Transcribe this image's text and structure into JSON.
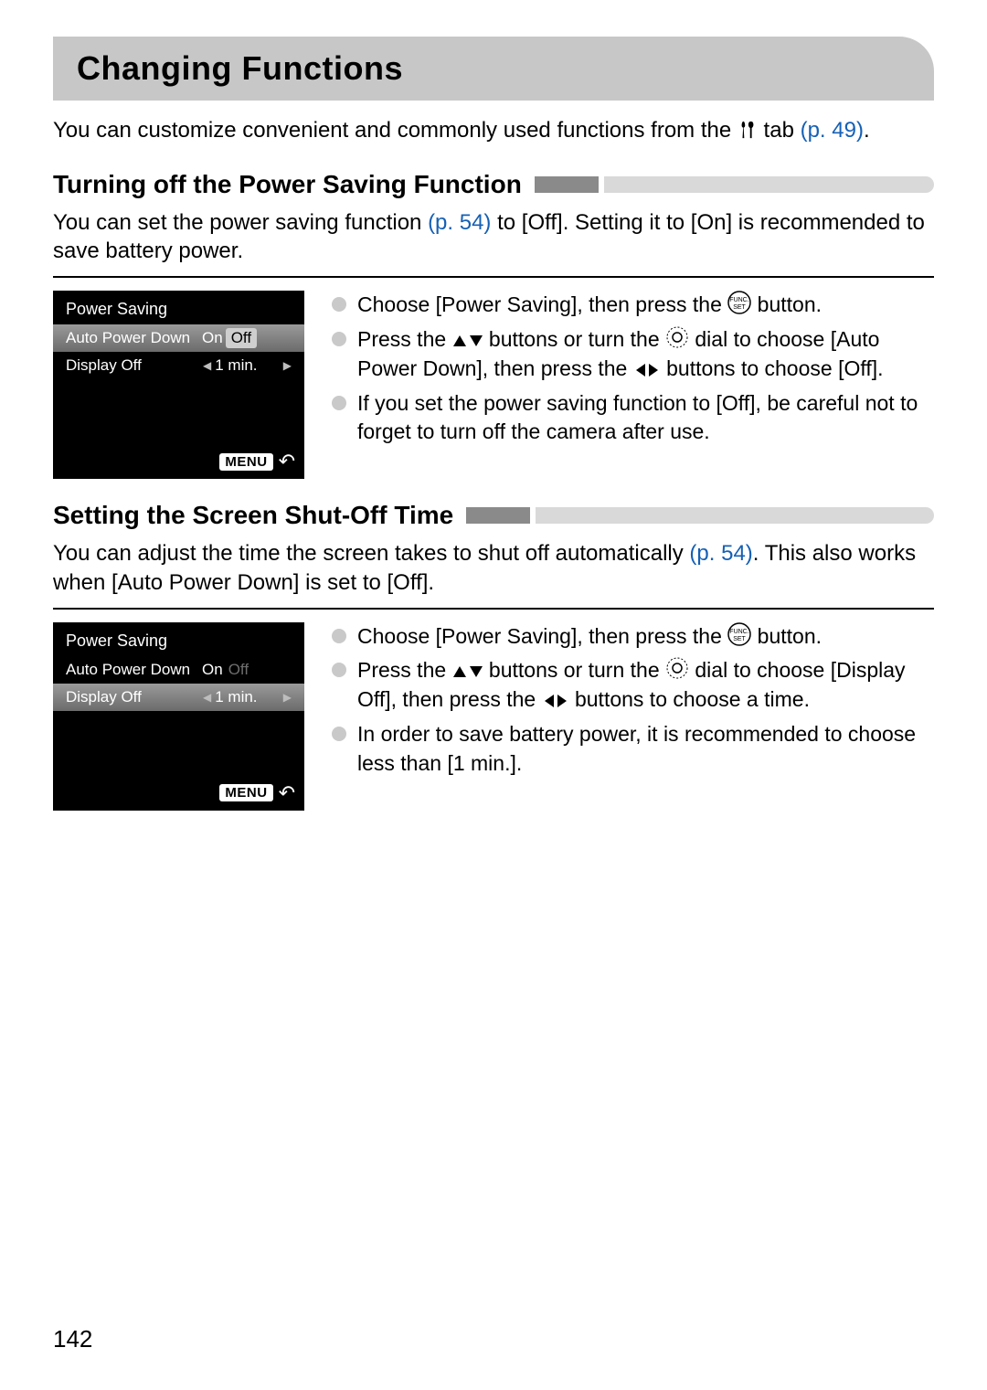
{
  "page": {
    "title": "Changing Functions",
    "intro_pre": "You can customize convenient and commonly used functions from the ",
    "intro_post": " tab ",
    "intro_ref": "(p. 49)",
    "intro_end": ".",
    "number": "142"
  },
  "s1": {
    "heading": "Turning off the Power Saving Function",
    "text_pre": "You can set the power saving function ",
    "text_ref": "(p. 54)",
    "text_post": " to [Off]. Setting it to [On] is recommended to save battery power.",
    "lcd": {
      "title": "Power Saving",
      "row1_label": "Auto Power Down",
      "row1_on": "On",
      "row1_off": "Off",
      "row2_label": "Display Off",
      "row2_value": "1 min.",
      "menu": "MENU"
    },
    "b1a": "Choose [Power Saving], then press the ",
    "b1b": " button.",
    "b2a": "Press the ",
    "b2b": " buttons or turn the ",
    "b2c": " dial to choose [Auto Power Down], then press the ",
    "b2d": " buttons to choose [Off].",
    "b3": "If you set the power saving function to [Off], be careful not to forget to turn off the camera after use."
  },
  "s2": {
    "heading": "Setting the Screen Shut-Off Time",
    "text_pre": "You can adjust the time the screen takes to shut off automatically ",
    "text_ref": "(p. 54)",
    "text_post": ". This also works when [Auto Power Down] is set to [Off].",
    "lcd": {
      "title": "Power Saving",
      "row1_label": "Auto Power Down",
      "row1_on": "On",
      "row1_off": "Off",
      "row2_label": "Display Off",
      "row2_value": "1 min.",
      "menu": "MENU"
    },
    "b1a": "Choose [Power Saving], then press the ",
    "b1b": " button.",
    "b2a": "Press the ",
    "b2b": " buttons or turn the ",
    "b2c": " dial to choose [Display Off], then press the ",
    "b2d": " buttons to choose a time.",
    "b3": "In order to save battery power, it is recommended to choose less than [1 min.]."
  }
}
